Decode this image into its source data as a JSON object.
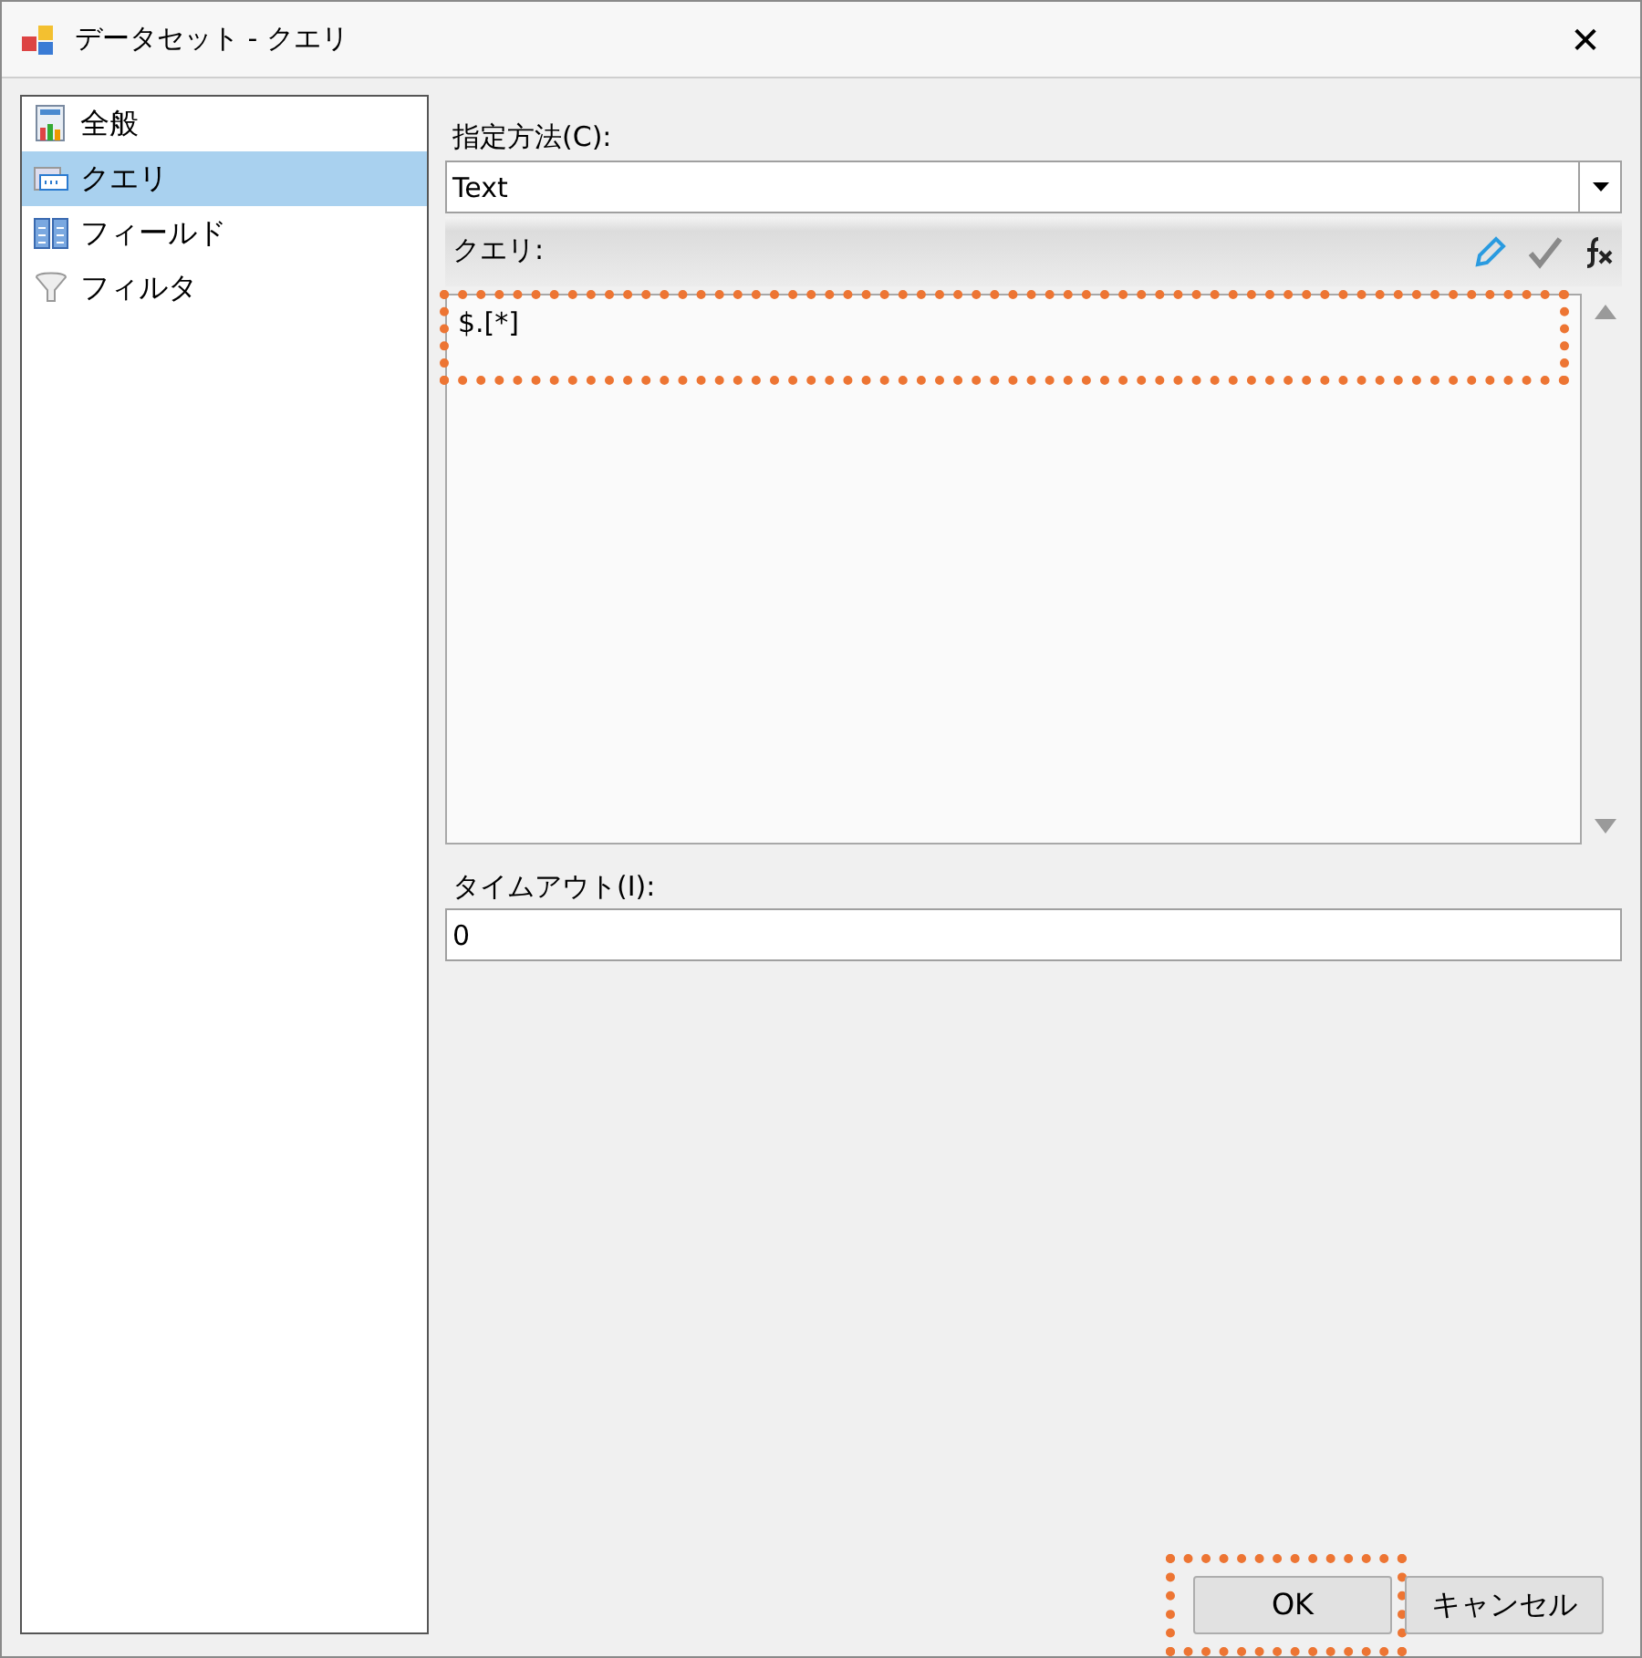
{
  "window": {
    "title": "データセット - クエリ",
    "close": "✕"
  },
  "sidebar": {
    "items": [
      {
        "label": "全般",
        "selected": false
      },
      {
        "label": "クエリ",
        "selected": true
      },
      {
        "label": "フィールド",
        "selected": false
      },
      {
        "label": "フィルタ",
        "selected": false
      }
    ]
  },
  "method": {
    "label": "指定方法(C):",
    "value": "Text"
  },
  "query": {
    "label": "クエリ:",
    "value": "$.[*]",
    "highlighted": true
  },
  "timeout": {
    "label": "タイムアウト(I):",
    "value": "0"
  },
  "buttons": [
    {
      "label": "OK",
      "highlighted": true
    },
    {
      "label": "キャンセル",
      "highlighted": false
    }
  ]
}
